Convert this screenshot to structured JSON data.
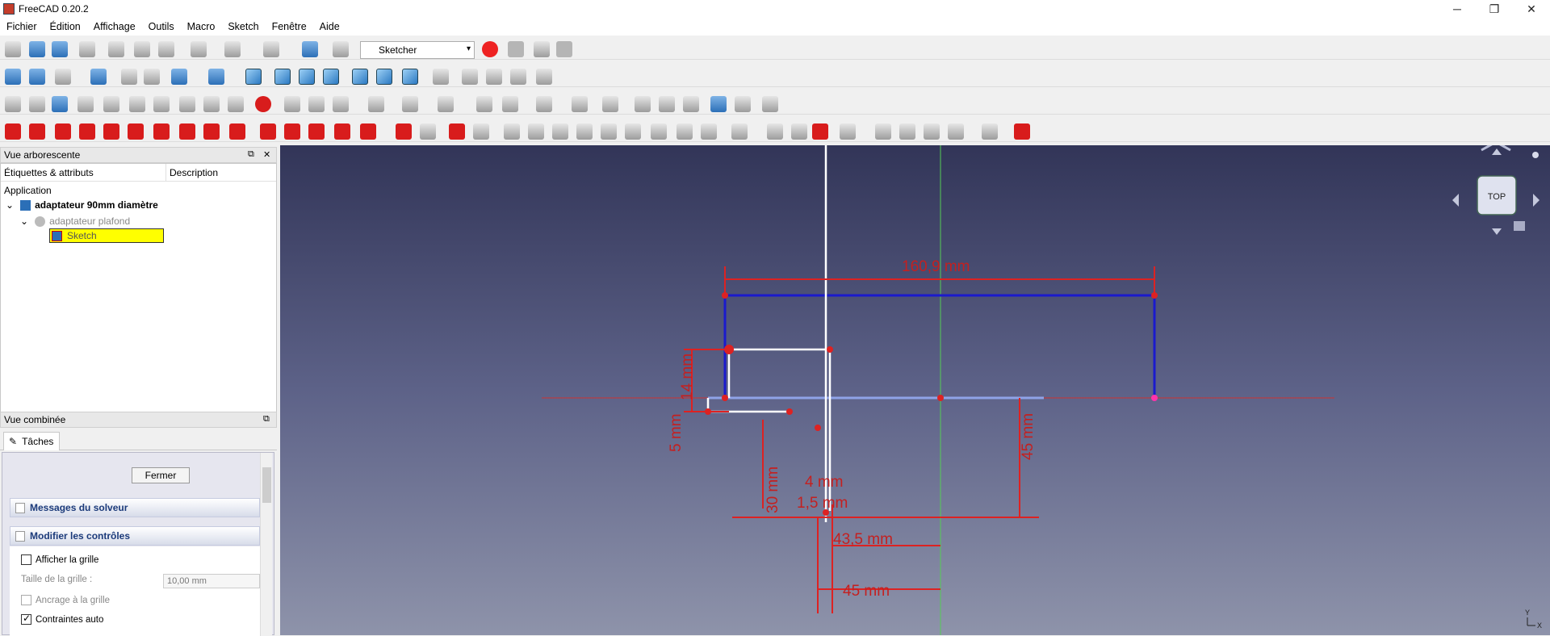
{
  "window": {
    "title": "FreeCAD 0.20.2",
    "controls": [
      "─",
      "❐",
      "✕"
    ]
  },
  "menu": [
    "Fichier",
    "Édition",
    "Affichage",
    "Outils",
    "Macro",
    "Sketch",
    "Fenêtre",
    "Aide"
  ],
  "toolbar": {
    "workbench": "Sketcher"
  },
  "tree_panel": {
    "title": "Vue arborescente",
    "col_labels": "Étiquettes & attributs",
    "col_description": "Description",
    "application": "Application",
    "doc": "adaptateur 90mm diamètre",
    "body": "adaptateur plafond",
    "sketch": "Sketch"
  },
  "combo_panel": {
    "title": "Vue combinée",
    "tab": "Tâches",
    "close_button": "Fermer",
    "solver_messages": "Messages du solveur",
    "edit_controls": "Modifier les contrôles",
    "show_grid": "Afficher la grille",
    "grid_size_label": "Taille de la grille :",
    "grid_size_value": "10,00 mm",
    "grid_snap": "Ancrage à la grille",
    "auto_constraints": "Contraintes auto"
  },
  "viewport": {
    "navcube_face": "TOP",
    "dim_top": "160,9 mm",
    "dim_left_a": "14 mm",
    "dim_left_b": "5 mm",
    "dim_30": "30 mm",
    "dim_4": "4 mm",
    "dim_15": "1,5 mm",
    "dim_45v": "45 mm",
    "dim_435": "43,5 mm",
    "dim_45h": "45 mm",
    "axis_y": "Y",
    "axis_x": "X"
  },
  "colors": {
    "accent_red": "#dd2222",
    "sketch_blue": "#1a1acd",
    "sketch_white": "#ffffff",
    "axis_green": "#55dd55"
  }
}
